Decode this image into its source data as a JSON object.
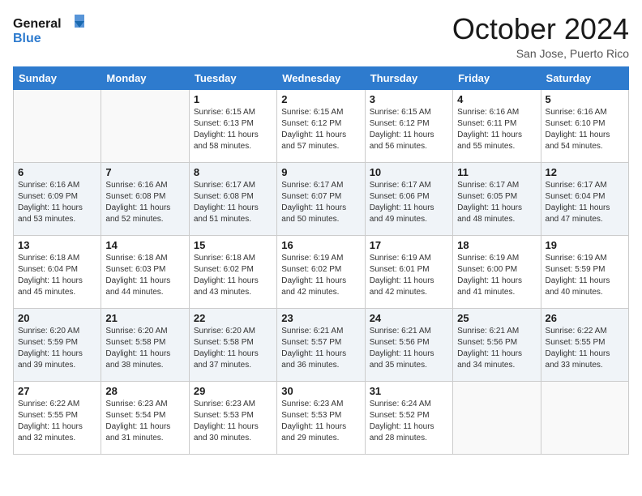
{
  "header": {
    "logo_line1": "General",
    "logo_line2": "Blue",
    "month": "October 2024",
    "location": "San Jose, Puerto Rico"
  },
  "weekdays": [
    "Sunday",
    "Monday",
    "Tuesday",
    "Wednesday",
    "Thursday",
    "Friday",
    "Saturday"
  ],
  "weeks": [
    [
      {
        "day": "",
        "sunrise": "",
        "sunset": "",
        "daylight": ""
      },
      {
        "day": "",
        "sunrise": "",
        "sunset": "",
        "daylight": ""
      },
      {
        "day": "1",
        "sunrise": "Sunrise: 6:15 AM",
        "sunset": "Sunset: 6:13 PM",
        "daylight": "Daylight: 11 hours and 58 minutes."
      },
      {
        "day": "2",
        "sunrise": "Sunrise: 6:15 AM",
        "sunset": "Sunset: 6:12 PM",
        "daylight": "Daylight: 11 hours and 57 minutes."
      },
      {
        "day": "3",
        "sunrise": "Sunrise: 6:15 AM",
        "sunset": "Sunset: 6:12 PM",
        "daylight": "Daylight: 11 hours and 56 minutes."
      },
      {
        "day": "4",
        "sunrise": "Sunrise: 6:16 AM",
        "sunset": "Sunset: 6:11 PM",
        "daylight": "Daylight: 11 hours and 55 minutes."
      },
      {
        "day": "5",
        "sunrise": "Sunrise: 6:16 AM",
        "sunset": "Sunset: 6:10 PM",
        "daylight": "Daylight: 11 hours and 54 minutes."
      }
    ],
    [
      {
        "day": "6",
        "sunrise": "Sunrise: 6:16 AM",
        "sunset": "Sunset: 6:09 PM",
        "daylight": "Daylight: 11 hours and 53 minutes."
      },
      {
        "day": "7",
        "sunrise": "Sunrise: 6:16 AM",
        "sunset": "Sunset: 6:08 PM",
        "daylight": "Daylight: 11 hours and 52 minutes."
      },
      {
        "day": "8",
        "sunrise": "Sunrise: 6:17 AM",
        "sunset": "Sunset: 6:08 PM",
        "daylight": "Daylight: 11 hours and 51 minutes."
      },
      {
        "day": "9",
        "sunrise": "Sunrise: 6:17 AM",
        "sunset": "Sunset: 6:07 PM",
        "daylight": "Daylight: 11 hours and 50 minutes."
      },
      {
        "day": "10",
        "sunrise": "Sunrise: 6:17 AM",
        "sunset": "Sunset: 6:06 PM",
        "daylight": "Daylight: 11 hours and 49 minutes."
      },
      {
        "day": "11",
        "sunrise": "Sunrise: 6:17 AM",
        "sunset": "Sunset: 6:05 PM",
        "daylight": "Daylight: 11 hours and 48 minutes."
      },
      {
        "day": "12",
        "sunrise": "Sunrise: 6:17 AM",
        "sunset": "Sunset: 6:04 PM",
        "daylight": "Daylight: 11 hours and 47 minutes."
      }
    ],
    [
      {
        "day": "13",
        "sunrise": "Sunrise: 6:18 AM",
        "sunset": "Sunset: 6:04 PM",
        "daylight": "Daylight: 11 hours and 45 minutes."
      },
      {
        "day": "14",
        "sunrise": "Sunrise: 6:18 AM",
        "sunset": "Sunset: 6:03 PM",
        "daylight": "Daylight: 11 hours and 44 minutes."
      },
      {
        "day": "15",
        "sunrise": "Sunrise: 6:18 AM",
        "sunset": "Sunset: 6:02 PM",
        "daylight": "Daylight: 11 hours and 43 minutes."
      },
      {
        "day": "16",
        "sunrise": "Sunrise: 6:19 AM",
        "sunset": "Sunset: 6:02 PM",
        "daylight": "Daylight: 11 hours and 42 minutes."
      },
      {
        "day": "17",
        "sunrise": "Sunrise: 6:19 AM",
        "sunset": "Sunset: 6:01 PM",
        "daylight": "Daylight: 11 hours and 42 minutes."
      },
      {
        "day": "18",
        "sunrise": "Sunrise: 6:19 AM",
        "sunset": "Sunset: 6:00 PM",
        "daylight": "Daylight: 11 hours and 41 minutes."
      },
      {
        "day": "19",
        "sunrise": "Sunrise: 6:19 AM",
        "sunset": "Sunset: 5:59 PM",
        "daylight": "Daylight: 11 hours and 40 minutes."
      }
    ],
    [
      {
        "day": "20",
        "sunrise": "Sunrise: 6:20 AM",
        "sunset": "Sunset: 5:59 PM",
        "daylight": "Daylight: 11 hours and 39 minutes."
      },
      {
        "day": "21",
        "sunrise": "Sunrise: 6:20 AM",
        "sunset": "Sunset: 5:58 PM",
        "daylight": "Daylight: 11 hours and 38 minutes."
      },
      {
        "day": "22",
        "sunrise": "Sunrise: 6:20 AM",
        "sunset": "Sunset: 5:58 PM",
        "daylight": "Daylight: 11 hours and 37 minutes."
      },
      {
        "day": "23",
        "sunrise": "Sunrise: 6:21 AM",
        "sunset": "Sunset: 5:57 PM",
        "daylight": "Daylight: 11 hours and 36 minutes."
      },
      {
        "day": "24",
        "sunrise": "Sunrise: 6:21 AM",
        "sunset": "Sunset: 5:56 PM",
        "daylight": "Daylight: 11 hours and 35 minutes."
      },
      {
        "day": "25",
        "sunrise": "Sunrise: 6:21 AM",
        "sunset": "Sunset: 5:56 PM",
        "daylight": "Daylight: 11 hours and 34 minutes."
      },
      {
        "day": "26",
        "sunrise": "Sunrise: 6:22 AM",
        "sunset": "Sunset: 5:55 PM",
        "daylight": "Daylight: 11 hours and 33 minutes."
      }
    ],
    [
      {
        "day": "27",
        "sunrise": "Sunrise: 6:22 AM",
        "sunset": "Sunset: 5:55 PM",
        "daylight": "Daylight: 11 hours and 32 minutes."
      },
      {
        "day": "28",
        "sunrise": "Sunrise: 6:23 AM",
        "sunset": "Sunset: 5:54 PM",
        "daylight": "Daylight: 11 hours and 31 minutes."
      },
      {
        "day": "29",
        "sunrise": "Sunrise: 6:23 AM",
        "sunset": "Sunset: 5:53 PM",
        "daylight": "Daylight: 11 hours and 30 minutes."
      },
      {
        "day": "30",
        "sunrise": "Sunrise: 6:23 AM",
        "sunset": "Sunset: 5:53 PM",
        "daylight": "Daylight: 11 hours and 29 minutes."
      },
      {
        "day": "31",
        "sunrise": "Sunrise: 6:24 AM",
        "sunset": "Sunset: 5:52 PM",
        "daylight": "Daylight: 11 hours and 28 minutes."
      },
      {
        "day": "",
        "sunrise": "",
        "sunset": "",
        "daylight": ""
      },
      {
        "day": "",
        "sunrise": "",
        "sunset": "",
        "daylight": ""
      }
    ]
  ]
}
